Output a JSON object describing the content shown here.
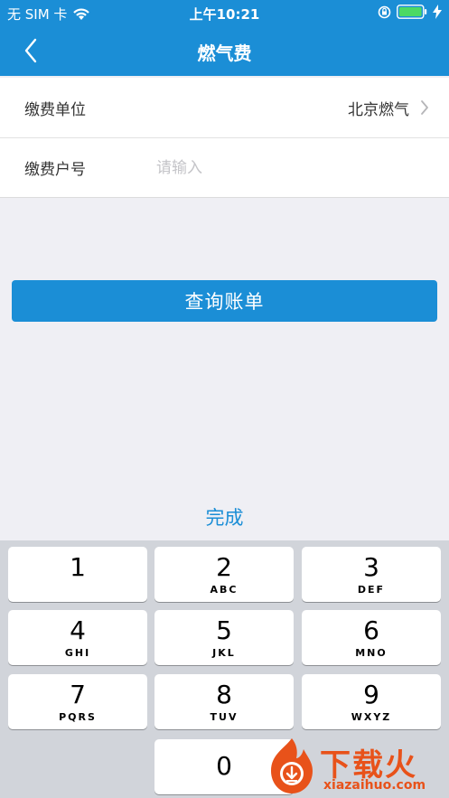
{
  "status_bar": {
    "carrier": "无 SIM 卡",
    "time": "上午10:21"
  },
  "nav": {
    "title": "燃气费",
    "back_icon": "chevron-left-icon"
  },
  "form": {
    "unit_label": "缴费单位",
    "unit_value": "北京燃气",
    "account_label": "缴费户号",
    "account_placeholder": "请输入",
    "account_value": ""
  },
  "query_button": "查询账单",
  "keyboard": {
    "done_label": "完成",
    "keys": [
      {
        "num": "1",
        "letters": ""
      },
      {
        "num": "2",
        "letters": "ABC"
      },
      {
        "num": "3",
        "letters": "DEF"
      },
      {
        "num": "4",
        "letters": "GHI"
      },
      {
        "num": "5",
        "letters": "JKL"
      },
      {
        "num": "6",
        "letters": "MNO"
      },
      {
        "num": "7",
        "letters": "PQRS"
      },
      {
        "num": "8",
        "letters": "TUV"
      },
      {
        "num": "9",
        "letters": "WXYZ"
      },
      {
        "num": "0",
        "letters": ""
      }
    ]
  },
  "watermark": {
    "title": "下载火",
    "url": "xiazaihuo.com"
  },
  "colors": {
    "accent": "#1b8ed6",
    "background": "#efeff4",
    "keyboard_bg": "#d1d4da",
    "watermark": "#e8521a"
  }
}
